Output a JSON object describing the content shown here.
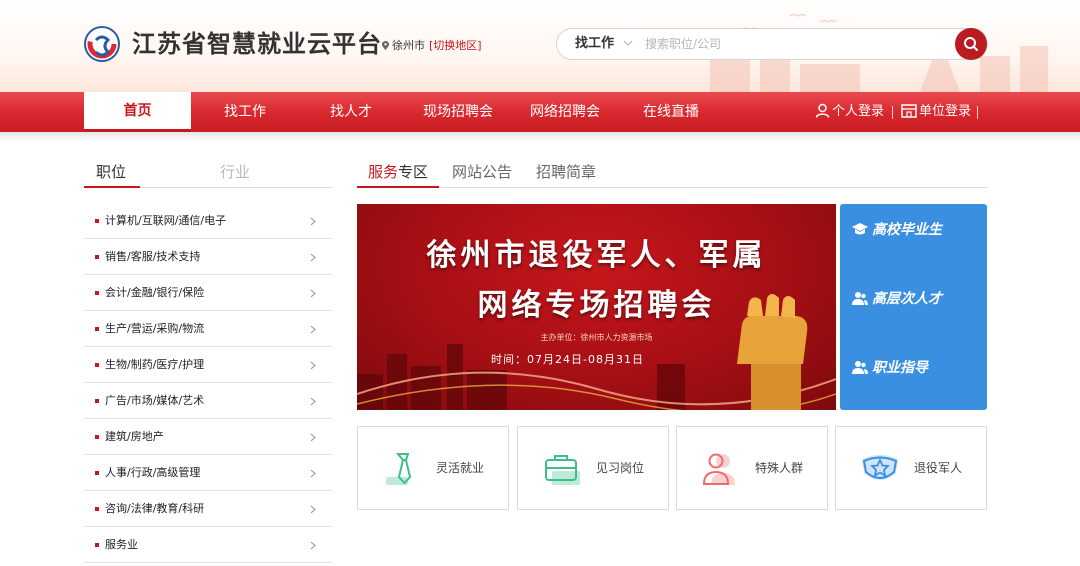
{
  "header": {
    "site_title": "江苏省智慧就业云平台",
    "location": "徐州市",
    "switch_region": "[切换地区]",
    "search": {
      "type_label": "找工作",
      "placeholder": "搜索职位/公司",
      "value": ""
    }
  },
  "nav": {
    "items": [
      {
        "label": "首页",
        "active": true
      },
      {
        "label": "找工作"
      },
      {
        "label": "找人才"
      },
      {
        "label": "现场招聘会"
      },
      {
        "label": "网络招聘会"
      },
      {
        "label": "在线直播"
      }
    ],
    "personal_login": "个人登录",
    "company_login": "单位登录"
  },
  "left_tabs": [
    "职位",
    "行业"
  ],
  "categories": [
    "计算机/互联网/通信/电子",
    "销售/客服/技术支持",
    "会计/金融/银行/保险",
    "生产/营运/采购/物流",
    "生物/制药/医疗/护理",
    "广告/市场/媒体/艺术",
    "建筑/房地产",
    "人事/行政/高级管理",
    "咨询/法律/教育/科研",
    "服务业"
  ],
  "service_tabs": {
    "active_highlight": "服务",
    "active_rest": "专区",
    "others": [
      "网站公告",
      "招聘简章"
    ]
  },
  "banner": {
    "title_line1": "徐州市退役军人、军属",
    "title_line2": "网络专场招聘会",
    "organizer": "主办单位：徐州市人力资源市场",
    "time": "时间：07月24日-08月31日"
  },
  "quick_links": [
    "高校毕业生",
    "高层次人才",
    "职业指导"
  ],
  "service_cards": [
    {
      "label": "灵活就业",
      "icon": "tie-icon",
      "color": "#3dbf8a"
    },
    {
      "label": "见习岗位",
      "icon": "briefcase-icon",
      "color": "#3dbf8a"
    },
    {
      "label": "特殊人群",
      "icon": "people-icon",
      "color": "#f06a6a"
    },
    {
      "label": "退役军人",
      "icon": "military-badge-icon",
      "color": "#3b8fe0"
    }
  ],
  "colors": {
    "brand_red": "#c8161d",
    "nav_red": "#d7272d",
    "panel_blue": "#3b8fe0"
  }
}
